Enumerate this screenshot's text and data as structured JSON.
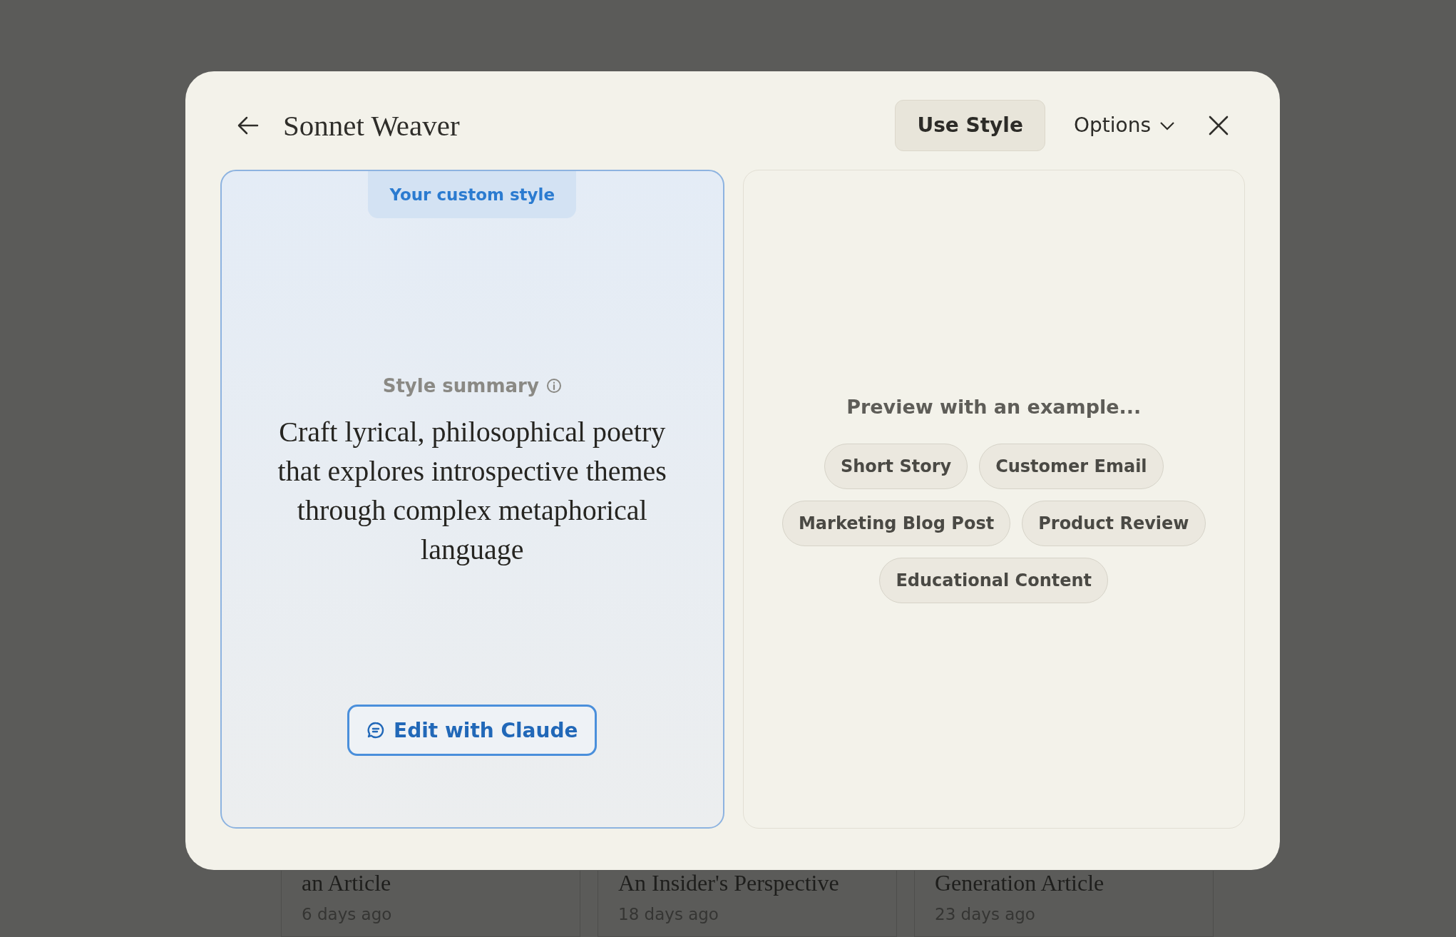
{
  "background_cards": [
    {
      "title": "an Article",
      "time": "6 days ago"
    },
    {
      "title": "An Insider's Perspective",
      "time": "18 days ago"
    },
    {
      "title": "Generation Article",
      "time": "23 days ago"
    }
  ],
  "dialog": {
    "title": "Sonnet Weaver",
    "use_button": "Use Style",
    "options_button": "Options",
    "style_panel": {
      "badge": "Your custom style",
      "summary_label": "Style summary",
      "summary": "Craft lyrical, philosophical poetry that explores introspective themes through complex metaphorical language",
      "edit_button": "Edit with Claude"
    },
    "preview_panel": {
      "heading": "Preview with an example...",
      "examples": [
        "Short Story",
        "Customer Email",
        "Marketing Blog Post",
        "Product Review",
        "Educational Content"
      ]
    }
  }
}
